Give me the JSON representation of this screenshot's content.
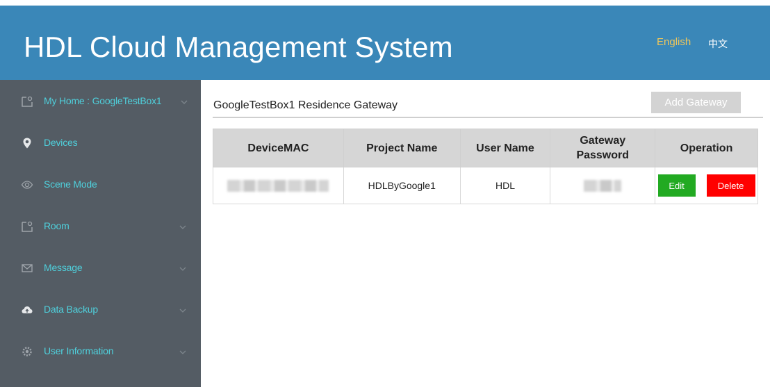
{
  "header": {
    "title": "HDL Cloud Management System",
    "lang_english": "English",
    "lang_chinese": "中文"
  },
  "sidebar": {
    "items": [
      {
        "label": "My Home : GoogleTestBox1",
        "icon": "home-outline-icon",
        "has_chevron": true
      },
      {
        "label": "Devices",
        "icon": "location-pin-icon",
        "has_chevron": false
      },
      {
        "label": "Scene Mode",
        "icon": "eye-icon",
        "has_chevron": false
      },
      {
        "label": "Room",
        "icon": "room-outline-icon",
        "has_chevron": true
      },
      {
        "label": "Message",
        "icon": "envelope-icon",
        "has_chevron": true
      },
      {
        "label": "Data Backup",
        "icon": "cloud-upload-icon",
        "has_chevron": true
      },
      {
        "label": "User Information",
        "icon": "gear-icon",
        "has_chevron": true
      }
    ]
  },
  "main": {
    "page_title": "GoogleTestBox1 Residence Gateway",
    "add_button": "Add Gateway",
    "table": {
      "headers": [
        "DeviceMAC",
        "Project Name",
        "User Name",
        "Gateway Password",
        "Operation"
      ],
      "rows": [
        {
          "project_name": "HDLByGoogle1",
          "user_name": "HDL",
          "edit_label": "Edit",
          "delete_label": "Delete"
        }
      ]
    }
  },
  "colors": {
    "header_bg": "#3a87b8",
    "sidebar_bg": "#545c64",
    "sidebar_text": "#4fd0dc",
    "lang_active": "#f0c75a",
    "edit_button": "#22aa22",
    "delete_button": "#ff0000",
    "add_button_disabled": "#d3d3d3"
  }
}
